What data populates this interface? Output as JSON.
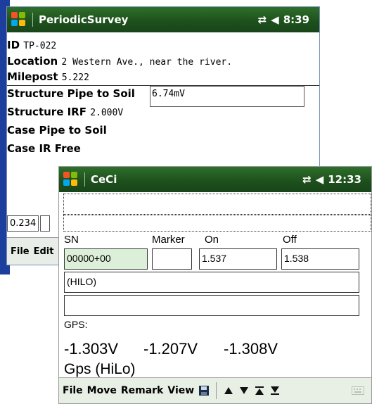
{
  "window1": {
    "title": "PeriodicSurvey",
    "time": "8:39",
    "rows": [
      {
        "label": "ID",
        "value": "TP-022"
      },
      {
        "label": "Location",
        "value": "2 Western Ave., near the river."
      },
      {
        "label": "Milepost",
        "value": "5.222"
      },
      {
        "label": "Structure Pipe to Soil",
        "value": ""
      },
      {
        "label": "Structure IRF",
        "value": "2.000V"
      },
      {
        "label": "Case Pipe to Soil",
        "value": ""
      },
      {
        "label": "Case IR Free",
        "value": ""
      }
    ],
    "pipe_to_soil_input": "6.74mV",
    "bottom_field": "0.234",
    "menu": [
      "File",
      "Edit"
    ]
  },
  "window2": {
    "title": "CeCi",
    "time": "12:33",
    "labels": {
      "sn": "SN",
      "marker": "Marker",
      "on": "On",
      "off": "Off",
      "gps": "GPS:"
    },
    "fields": {
      "sn": "00000+00",
      "marker": "",
      "on": "1.537",
      "off": "1.538",
      "hilo": "(HILO)",
      "blank": ""
    },
    "readings": [
      "-1.303V",
      "-1.207V",
      "-1.308V"
    ],
    "gps_mode": "Gps (HiLo)",
    "menu": [
      "File",
      "Move",
      "Remark",
      "View"
    ],
    "colors": {
      "titlebar": "#1d4f1c",
      "sn_field": "#dcefd8"
    }
  }
}
